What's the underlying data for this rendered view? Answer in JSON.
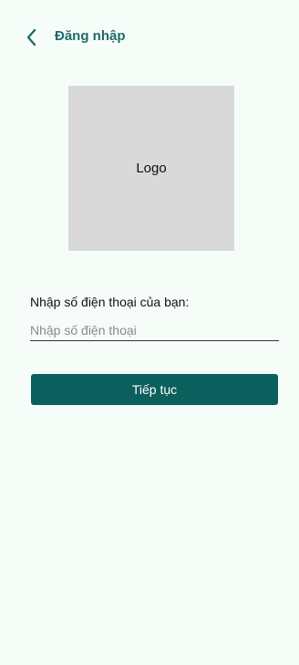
{
  "header": {
    "back_icon": "chevron-left-icon",
    "title": "Đăng nhập"
  },
  "logo": {
    "label": "Logo"
  },
  "form": {
    "phone_label": "Nhập số điện thoại của bạn:",
    "phone_placeholder": "Nhập số điện thoại",
    "phone_value": ""
  },
  "actions": {
    "continue_label": "Tiếp tục"
  },
  "colors": {
    "background": "#f6fdf9",
    "accent": "#0b5f5c",
    "title": "#1f6b6b",
    "logo_placeholder": "#d9d9d9"
  }
}
